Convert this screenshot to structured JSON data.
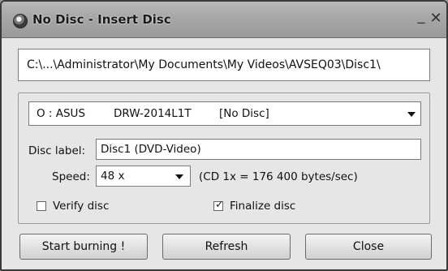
{
  "window": {
    "title": "No Disc - Insert Disc",
    "minimize_glyph": "_",
    "close_glyph": "✕"
  },
  "path": {
    "value": "C:\\...\\Administrator\\My Documents\\My Videos\\AVSEQ03\\Disc1\\"
  },
  "drive": {
    "letter": "O : ASUS",
    "model": "DRW-2014L1T",
    "status": "[No Disc]"
  },
  "disc_label": {
    "label": "Disc label:",
    "value": "Disc1 (DVD-Video)"
  },
  "speed": {
    "label": "Speed:",
    "selected": "48 x",
    "info": "(CD 1x = 176 400 bytes/sec)"
  },
  "options": {
    "verify": {
      "label": "Verify disc",
      "checked": false
    },
    "finalize": {
      "label": "Finalize disc",
      "checked": true,
      "mark": "✓"
    }
  },
  "buttons": {
    "start": "Start burning !",
    "refresh": "Refresh",
    "close": "Close"
  }
}
